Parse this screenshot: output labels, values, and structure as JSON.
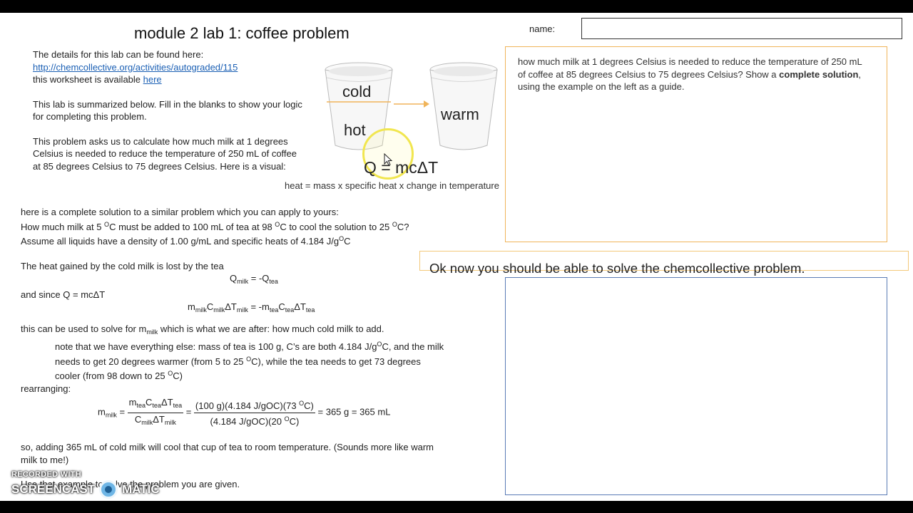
{
  "header": {
    "title": "module 2 lab 1: coffee problem",
    "name_label": "name:"
  },
  "intro": {
    "details": "The details for this lab can be found here:",
    "link": "http://chemcollective.org/activities/autograded/115",
    "worksheet_prefix": "this worksheet is available ",
    "worksheet_link": "here",
    "summary_line1": "This lab is summarized below. Fill in the blanks to show your logic",
    "summary_line2": "for completing this problem.",
    "problem_line1": "This problem asks us to calculate how much milk at 1 degrees",
    "problem_line2": "Celsius is needed to reduce the temperature of  250 mL of coffee",
    "problem_line3": "at 85 degrees Celsius to 75 degrees Celsius. Here is a visual:"
  },
  "visual": {
    "cold": "cold",
    "hot": "hot",
    "warm": "warm",
    "equation": "Q = mcΔT",
    "caption": "heat = mass x specific heat x change in temperature",
    "icons": [
      "foam-cup-icon",
      "arrow-right-icon",
      "cursor-icon"
    ],
    "colors": {
      "orange": "#f0b45a",
      "blue": "#5a7bb5",
      "highlight": "#f1e64f"
    }
  },
  "question": {
    "text1": "how much milk at 1 degrees Celsius is needed to reduce the temperature of 250 mL of coffee at 85 degrees Celsius to 75 degrees Celsius? Show a ",
    "bold": "complete solution",
    "text2": ", using the example on the left as a guide."
  },
  "banner": "Ok now you should be able to solve the chemcollective problem.",
  "example": {
    "intro": "here is a complete solution to a similar problem which you can apply to yours:",
    "q1a": "How much milk at 5 ",
    "q1b": "C must be added to 100 mL of tea at 98 ",
    "q1c": "C to cool the solution to 25 ",
    "q1d": "C?",
    "q2a": "Assume all liquids  have a density of 1.00 g/mL and specific heats of 4.184 J/g",
    "q2b": "C",
    "deg": "O",
    "heat_line": "The heat gained by the cold milk is lost by the tea",
    "eq1_q": "Q",
    "milk": "milk",
    "eq1_mid": " = -Q",
    "tea": "tea",
    "since": "and since Q = mcΔT",
    "m": "m",
    "c": "C",
    "dt": "ΔT",
    "eq_minus": " = -m",
    "use_a": "this can be used to solve for m",
    "use_b": " which is what we are after: how much cold milk to add.",
    "note1a": "note that we have everything else: mass of tea is 100 g, C’s are both 4.184 J/g",
    "note1b": "C, and the milk",
    "note2a": "needs to get 20 degrees warmer (from 5 to 25 ",
    "note2b": "C), while the tea needs to get 73 degrees",
    "note3a": "cooler (from 98 down to 25 ",
    "note3b": "C)",
    "rearranging": "rearranging:",
    "eq_equals": " = ",
    "num2": "(100 g)(4.184 J/gOC)(73 ",
    "num2b": "C)",
    "den2": "(4.184 J/gOC)(20 ",
    "den2b": "C)",
    "result": " = 365 g = 365 mL",
    "so1": "so, adding 365 mL of cold milk will  cool that cup of tea to room temperature. (Sounds more like warm",
    "so2": "milk to me!)",
    "use_example": "Use that example to solve the problem you are given."
  },
  "watermark": {
    "top": "RECORDED WITH",
    "left": "SCREENCAST",
    "right": "MATIC"
  }
}
